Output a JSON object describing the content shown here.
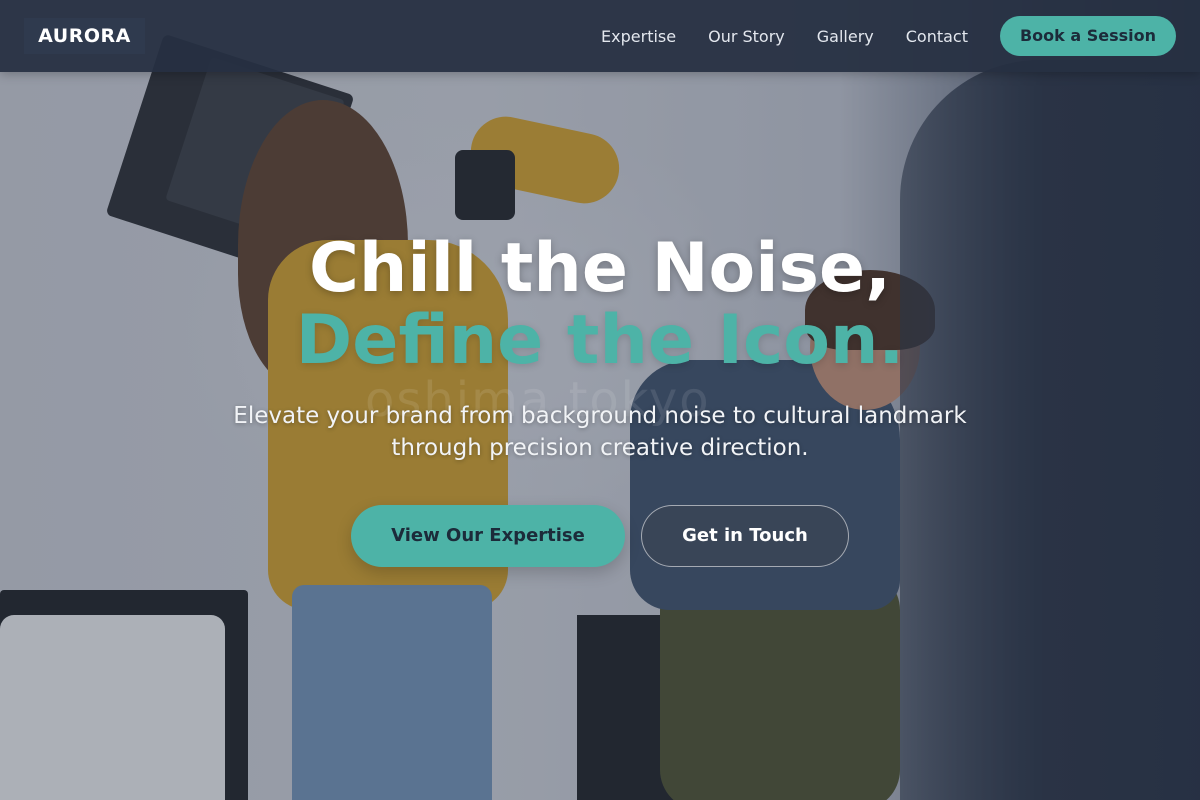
{
  "nav": {
    "logo": "AURORA",
    "links": [
      "Expertise",
      "Our Story",
      "Gallery",
      "Contact"
    ],
    "cta": "Book a Session"
  },
  "hero": {
    "headline_line1": "Chill the Noise,",
    "headline_line2": "Define the Icon.",
    "subtitle": "Elevate your brand from background noise to cultural landmark through precision creative direction.",
    "primary_cta": "View Our Expertise",
    "secondary_cta": "Get in Touch",
    "watermark": "oshima tokyo"
  },
  "colors": {
    "accent": "#4db3a7",
    "navbar": "#263042",
    "text_dark": "#1c2b3a"
  }
}
